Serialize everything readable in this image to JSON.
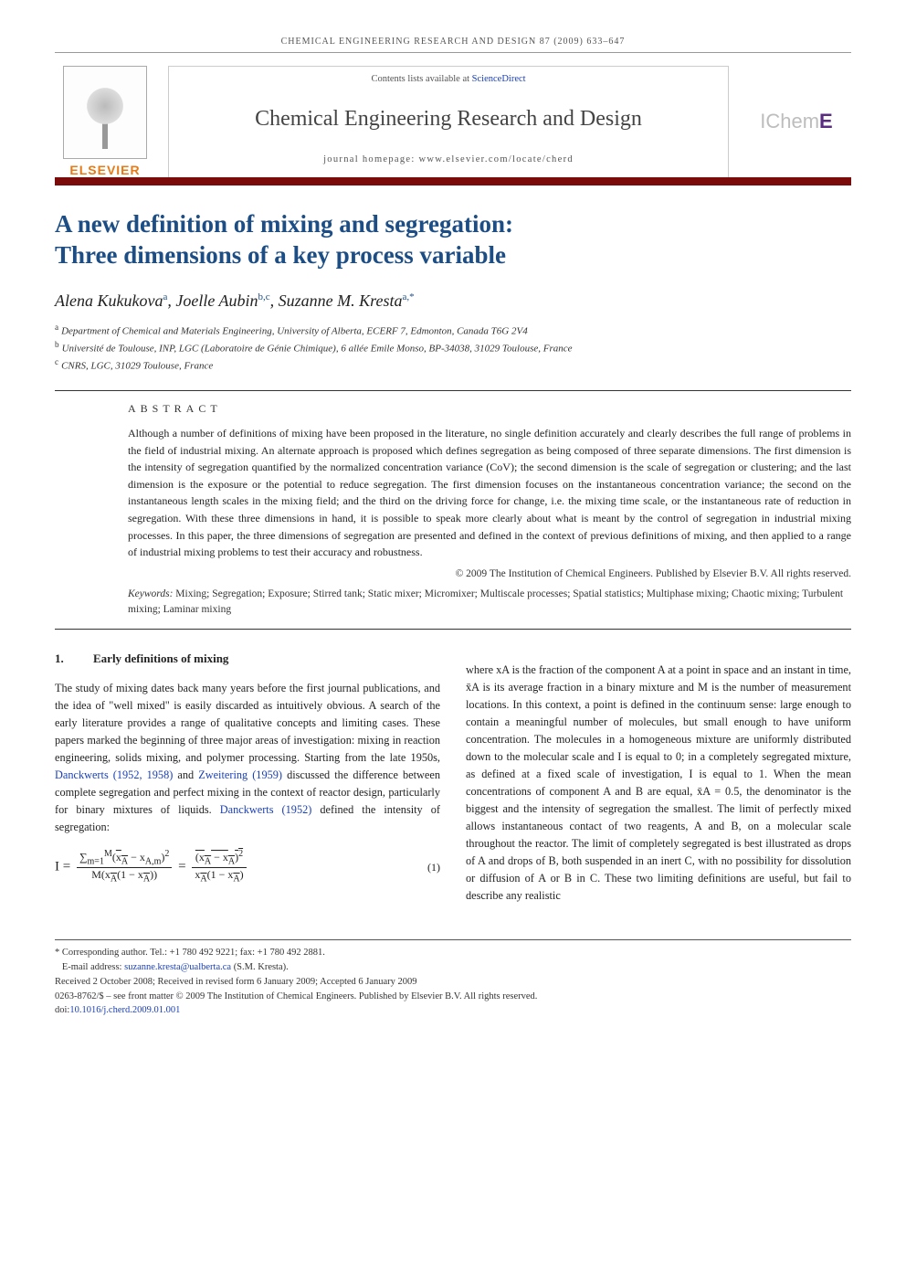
{
  "running_head": "CHEMICAL ENGINEERING RESEARCH AND DESIGN 87 (2009) 633–647",
  "masthead": {
    "contents_prefix": "Contents lists available at ",
    "contents_link": "ScienceDirect",
    "journal_title": "Chemical Engineering Research and Design",
    "homepage_label": "journal homepage: www.elsevier.com/locate/cherd",
    "elsevier_wordmark": "ELSEVIER",
    "icheme_text": "IChem",
    "icheme_e": "E"
  },
  "title_line1": "A new definition of mixing and segregation:",
  "title_line2": "Three dimensions of a key process variable",
  "authors_html": "Alena Kukukova",
  "authors": {
    "a1_name": "Alena Kukukova",
    "a1_sup": "a",
    "a2_name": "Joelle Aubin",
    "a2_sup": "b,c",
    "a3_name": "Suzanne M. Kresta",
    "a3_sup": "a,*"
  },
  "affiliations": {
    "a": "Department of Chemical and Materials Engineering, University of Alberta, ECERF 7, Edmonton, Canada T6G 2V4",
    "b": "Université de Toulouse, INP, LGC (Laboratoire de Génie Chimique), 6 allée Emile Monso, BP-34038, 31029 Toulouse, France",
    "c": "CNRS, LGC, 31029 Toulouse, France"
  },
  "abstract": {
    "label": "ABSTRACT",
    "text": "Although a number of definitions of mixing have been proposed in the literature, no single definition accurately and clearly describes the full range of problems in the field of industrial mixing. An alternate approach is proposed which defines segregation as being composed of three separate dimensions. The first dimension is the intensity of segregation quantified by the normalized concentration variance (CoV); the second dimension is the scale of segregation or clustering; and the last dimension is the exposure or the potential to reduce segregation. The first dimension focuses on the instantaneous concentration variance; the second on the instantaneous length scales in the mixing field; and the third on the driving force for change, i.e. the mixing time scale, or the instantaneous rate of reduction in segregation. With these three dimensions in hand, it is possible to speak more clearly about what is meant by the control of segregation in industrial mixing processes. In this paper, the three dimensions of segregation are presented and defined in the context of previous definitions of mixing, and then applied to a range of industrial mixing problems to test their accuracy and robustness.",
    "copyright": "© 2009 The Institution of Chemical Engineers. Published by Elsevier B.V. All rights reserved.",
    "keywords_label": "Keywords:",
    "keywords": "Mixing; Segregation; Exposure; Stirred tank; Static mixer; Micromixer; Multiscale processes; Spatial statistics; Multiphase mixing; Chaotic mixing; Turbulent mixing; Laminar mixing"
  },
  "section1": {
    "num": "1.",
    "heading": "Early definitions of mixing",
    "p1a": "The study of mixing dates back many years before the first journal publications, and the idea of \"well mixed\" is easily discarded as intuitively obvious. A search of the early literature provides a range of qualitative concepts and limiting cases. These papers marked the beginning of three major areas of investigation: mixing in reaction engineering, solids mixing, and polymer processing. Starting from the late 1950s, ",
    "cite1": "Danckwerts (1952, 1958)",
    "p1b": " and ",
    "cite2": "Zweitering (1959)",
    "p1c": " discussed the difference between complete segregation and perfect mixing in the context of reactor design, particularly for binary mixtures of liquids. ",
    "cite3": "Danckwerts (1952)",
    "p1d": " defined the intensity of segregation:",
    "eq_num": "(1)",
    "p2": "where xA is the fraction of the component A at a point in space and an instant in time, x̄A is its average fraction in a binary mixture and M is the number of measurement locations. In this context, a point is defined in the continuum sense: large enough to contain a meaningful number of molecules, but small enough to have uniform concentration. The molecules in a homogeneous mixture are uniformly distributed down to the molecular scale and I is equal to 0; in a completely segregated mixture, as defined at a fixed scale of investigation, I is equal to 1. When the mean concentrations of component A and B are equal, x̄A = 0.5, the denominator is the biggest and the intensity of segregation the smallest. The limit of perfectly mixed allows instantaneous contact of two reagents, A and B, on a molecular scale throughout the reactor. The limit of completely segregated is best illustrated as drops of A and drops of B, both suspended in an inert C, with no possibility for dissolution or diffusion of A or B in C. These two limiting definitions are useful, but fail to describe any realistic"
  },
  "footnotes": {
    "corresponding": "* Corresponding author. Tel.: +1 780 492 9221; fax: +1 780 492 2881.",
    "email_label": "E-mail address: ",
    "email": "suzanne.kresta@ualberta.ca",
    "email_suffix": " (S.M. Kresta).",
    "history": "Received 2 October 2008; Received in revised form 6 January 2009; Accepted 6 January 2009",
    "issn": "0263-8762/$ – see front matter © 2009 The Institution of Chemical Engineers. Published by Elsevier B.V. All rights reserved.",
    "doi_label": "doi:",
    "doi": "10.1016/j.cherd.2009.01.001"
  }
}
